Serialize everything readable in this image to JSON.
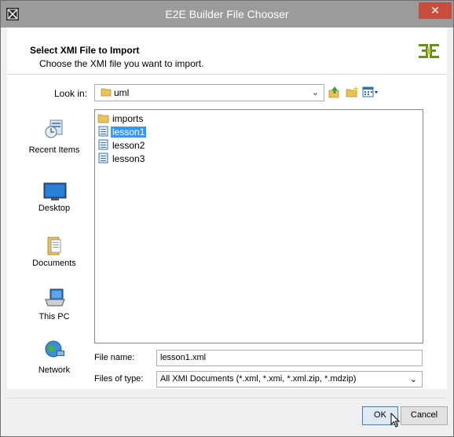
{
  "window": {
    "title": "E2E Builder File Chooser",
    "close_glyph": "✕"
  },
  "header": {
    "title": "Select XMI File to Import",
    "subtitle": "Choose the XMI file you want to import.",
    "logo_icon": "e2e-logo-icon"
  },
  "lookin": {
    "label": "Look in:",
    "value": "uml",
    "arrow": "⌄"
  },
  "toolbar": {
    "icons": [
      "up-folder-icon",
      "new-folder-icon",
      "view-menu-icon"
    ]
  },
  "places": [
    {
      "label": "Recent Items",
      "icon": "recent-items-icon"
    },
    {
      "label": "Desktop",
      "icon": "desktop-icon"
    },
    {
      "label": "Documents",
      "icon": "documents-icon"
    },
    {
      "label": "This PC",
      "icon": "this-pc-icon"
    },
    {
      "label": "Network",
      "icon": "network-icon"
    }
  ],
  "files": [
    {
      "name": "imports",
      "type": "folder",
      "selected": false
    },
    {
      "name": "lesson1",
      "type": "file",
      "selected": true
    },
    {
      "name": "lesson2",
      "type": "file",
      "selected": false
    },
    {
      "name": "lesson3",
      "type": "file",
      "selected": false
    }
  ],
  "filename": {
    "label": "File name:",
    "value": "lesson1.xml"
  },
  "filetype": {
    "label": "Files of type:",
    "value": "All XMI Documents (*.xml, *.xmi, *.xml.zip, *.mdzip)",
    "arrow": "⌄"
  },
  "buttons": {
    "ok": "OK",
    "cancel": "Cancel"
  },
  "colors": {
    "selection": "#3399ff",
    "titlebar": "#9b9b9b",
    "close": "#c84d3d",
    "logo": "#6a8f1f"
  }
}
